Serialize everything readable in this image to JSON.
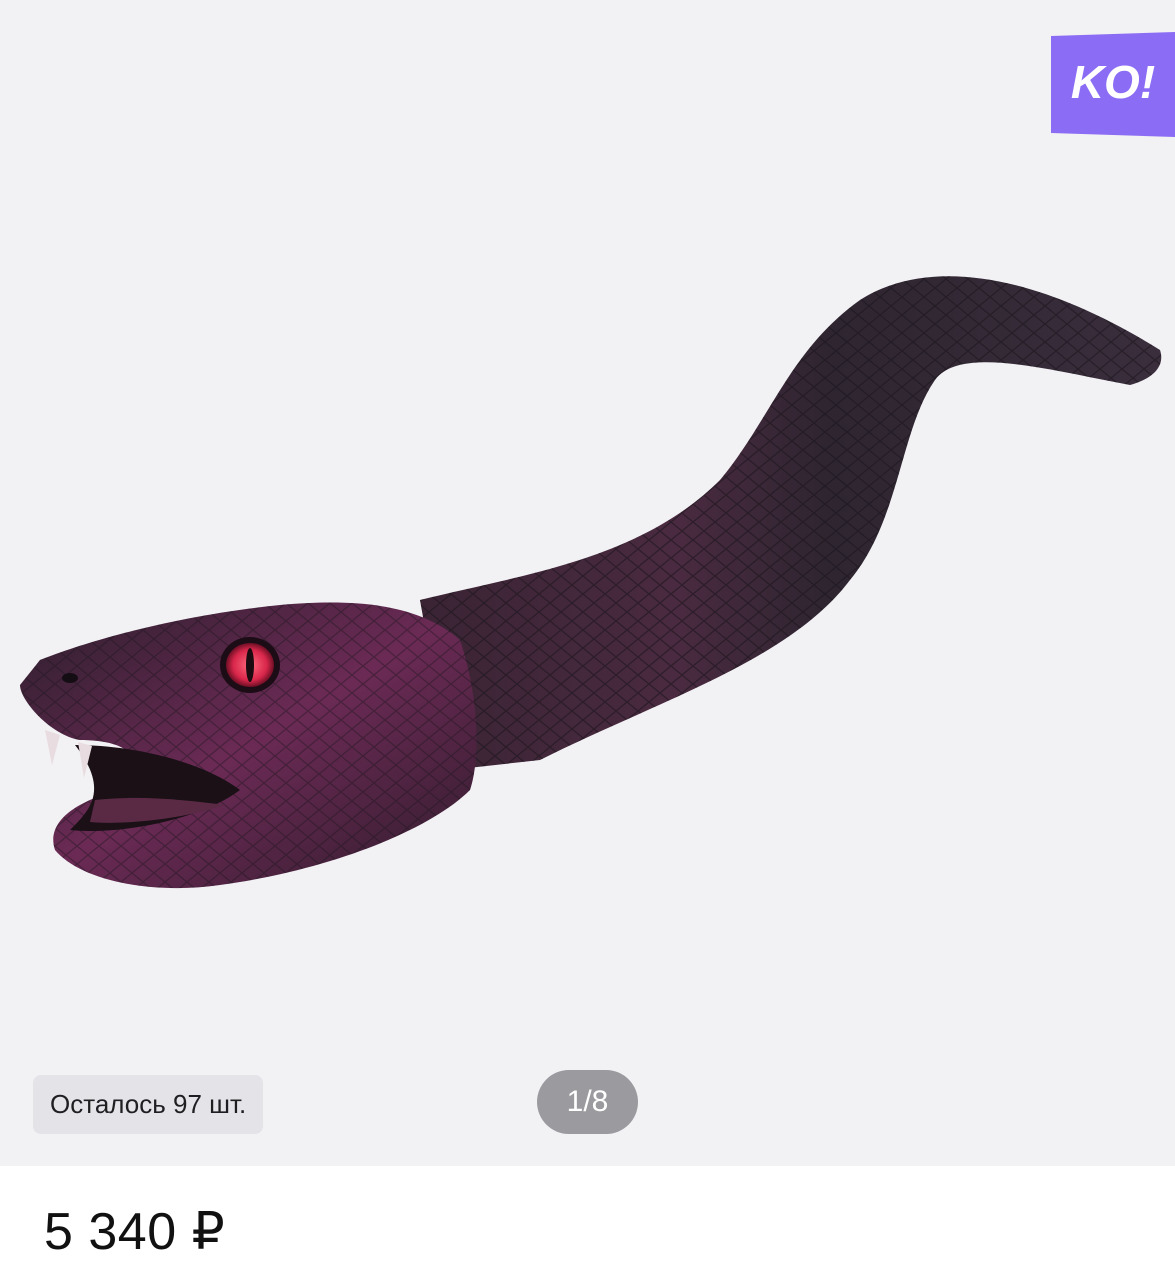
{
  "brand": {
    "logo_text": "KO!",
    "color": "#8b6cf5"
  },
  "gallery": {
    "image_icon": "snake-toy-photo",
    "stock_label": "Осталось 97 шт.",
    "pager": "1/8"
  },
  "product": {
    "price": "5 340 ₽"
  }
}
